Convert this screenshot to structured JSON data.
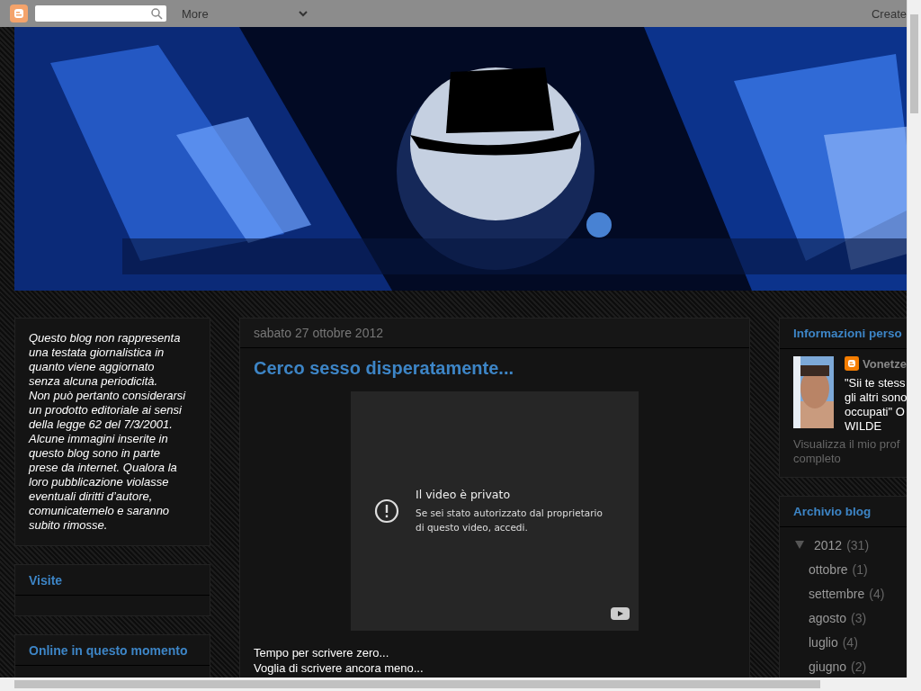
{
  "navbar": {
    "more": "More",
    "create": "Create"
  },
  "sidebar_left": [
    {
      "kind": "text",
      "paragraphs": [
        "Questo blog non rappresenta una testata giornalistica in quanto viene aggiornato senza alcuna periodicità.",
        "Non può pertanto considerarsi un prodotto editoriale ai sensi della legge 62 del 7/3/2001.",
        "Alcune immagini inserite in questo blog sono in parte prese da internet. Qualora la loro pubblicazione violasse eventuali diritti d’autore, comunicatemelo e saranno subito rimosse."
      ]
    },
    {
      "kind": "widget",
      "title": "Visite"
    },
    {
      "kind": "widget",
      "title": "Online in questo momento"
    }
  ],
  "post": {
    "date": "sabato 27 ottobre 2012",
    "title": "Cerco sesso disperatamente...",
    "video": {
      "title": "Il video è privato",
      "message": "Se sei stato autorizzato dal proprietario di questo video, accedi."
    },
    "body": [
      "Tempo per scrivere zero...",
      "Voglia di scrivere ancora meno..."
    ]
  },
  "sidebar_right": {
    "profile": {
      "title": "Informazioni perso",
      "name": "Vonetze",
      "quote_lines": [
        "\"Sii te stess",
        "gli altri sono",
        "occupati\" O",
        "WILDE"
      ],
      "link_lines": [
        "Visualizza il mio prof",
        "completo"
      ]
    },
    "archive": {
      "title": "Archivio blog",
      "years": [
        {
          "year": "2012",
          "count": "(31)",
          "expanded": true,
          "months": [
            {
              "name": "ottobre",
              "count": "(1)"
            },
            {
              "name": "settembre",
              "count": "(4)"
            },
            {
              "name": "agosto",
              "count": "(3)"
            },
            {
              "name": "luglio",
              "count": "(4)"
            },
            {
              "name": "giugno",
              "count": "(2)"
            }
          ]
        }
      ]
    }
  }
}
